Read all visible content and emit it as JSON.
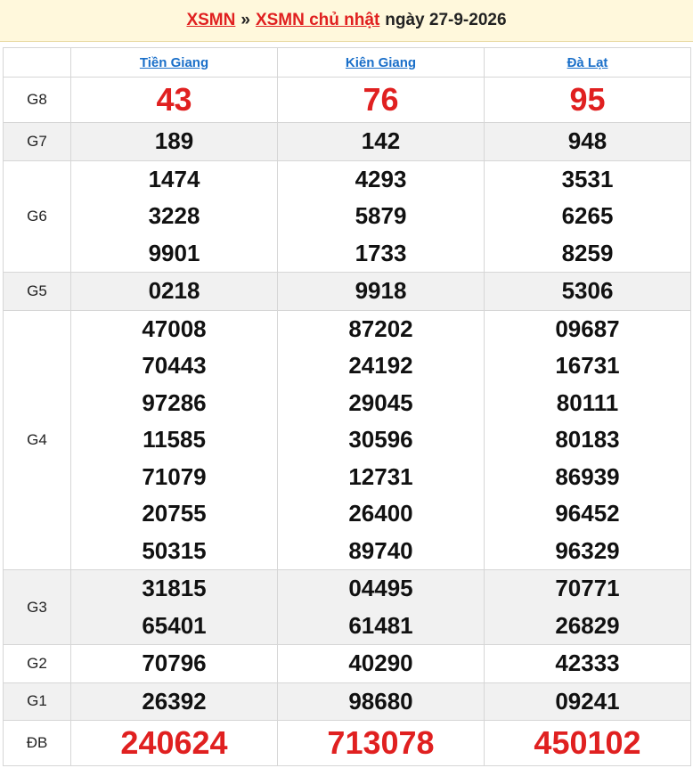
{
  "header": {
    "link1": "XSMN",
    "separator": "»",
    "link2": "XSMN chủ nhật",
    "date_text": "ngày 27-9-2026"
  },
  "provinces": [
    "Tiền Giang",
    "Kiên Giang",
    "Đà Lạt"
  ],
  "rows": [
    {
      "label": "G8",
      "values": [
        [
          "43"
        ],
        [
          "76"
        ],
        [
          "95"
        ]
      ]
    },
    {
      "label": "G7",
      "values": [
        [
          "189"
        ],
        [
          "142"
        ],
        [
          "948"
        ]
      ]
    },
    {
      "label": "G6",
      "values": [
        [
          "1474",
          "3228",
          "9901"
        ],
        [
          "4293",
          "5879",
          "1733"
        ],
        [
          "3531",
          "6265",
          "8259"
        ]
      ]
    },
    {
      "label": "G5",
      "values": [
        [
          "0218"
        ],
        [
          "9918"
        ],
        [
          "5306"
        ]
      ]
    },
    {
      "label": "G4",
      "values": [
        [
          "47008",
          "70443",
          "97286",
          "11585",
          "71079",
          "20755",
          "50315"
        ],
        [
          "87202",
          "24192",
          "29045",
          "30596",
          "12731",
          "26400",
          "89740"
        ],
        [
          "09687",
          "16731",
          "80111",
          "80183",
          "86939",
          "96452",
          "96329"
        ]
      ]
    },
    {
      "label": "G3",
      "values": [
        [
          "31815",
          "65401"
        ],
        [
          "04495",
          "61481"
        ],
        [
          "70771",
          "26829"
        ]
      ]
    },
    {
      "label": "G2",
      "values": [
        [
          "70796"
        ],
        [
          "40290"
        ],
        [
          "42333"
        ]
      ]
    },
    {
      "label": "G1",
      "values": [
        [
          "26392"
        ],
        [
          "98680"
        ],
        [
          "09241"
        ]
      ]
    },
    {
      "label": "ĐB",
      "values": [
        [
          "240624"
        ],
        [
          "713078"
        ],
        [
          "450102"
        ]
      ]
    }
  ],
  "colors": {
    "accent": "#e02020",
    "link": "#1a6fc9",
    "header_bg": "#fff8dc",
    "alt_row": "#f1f1f1"
  }
}
